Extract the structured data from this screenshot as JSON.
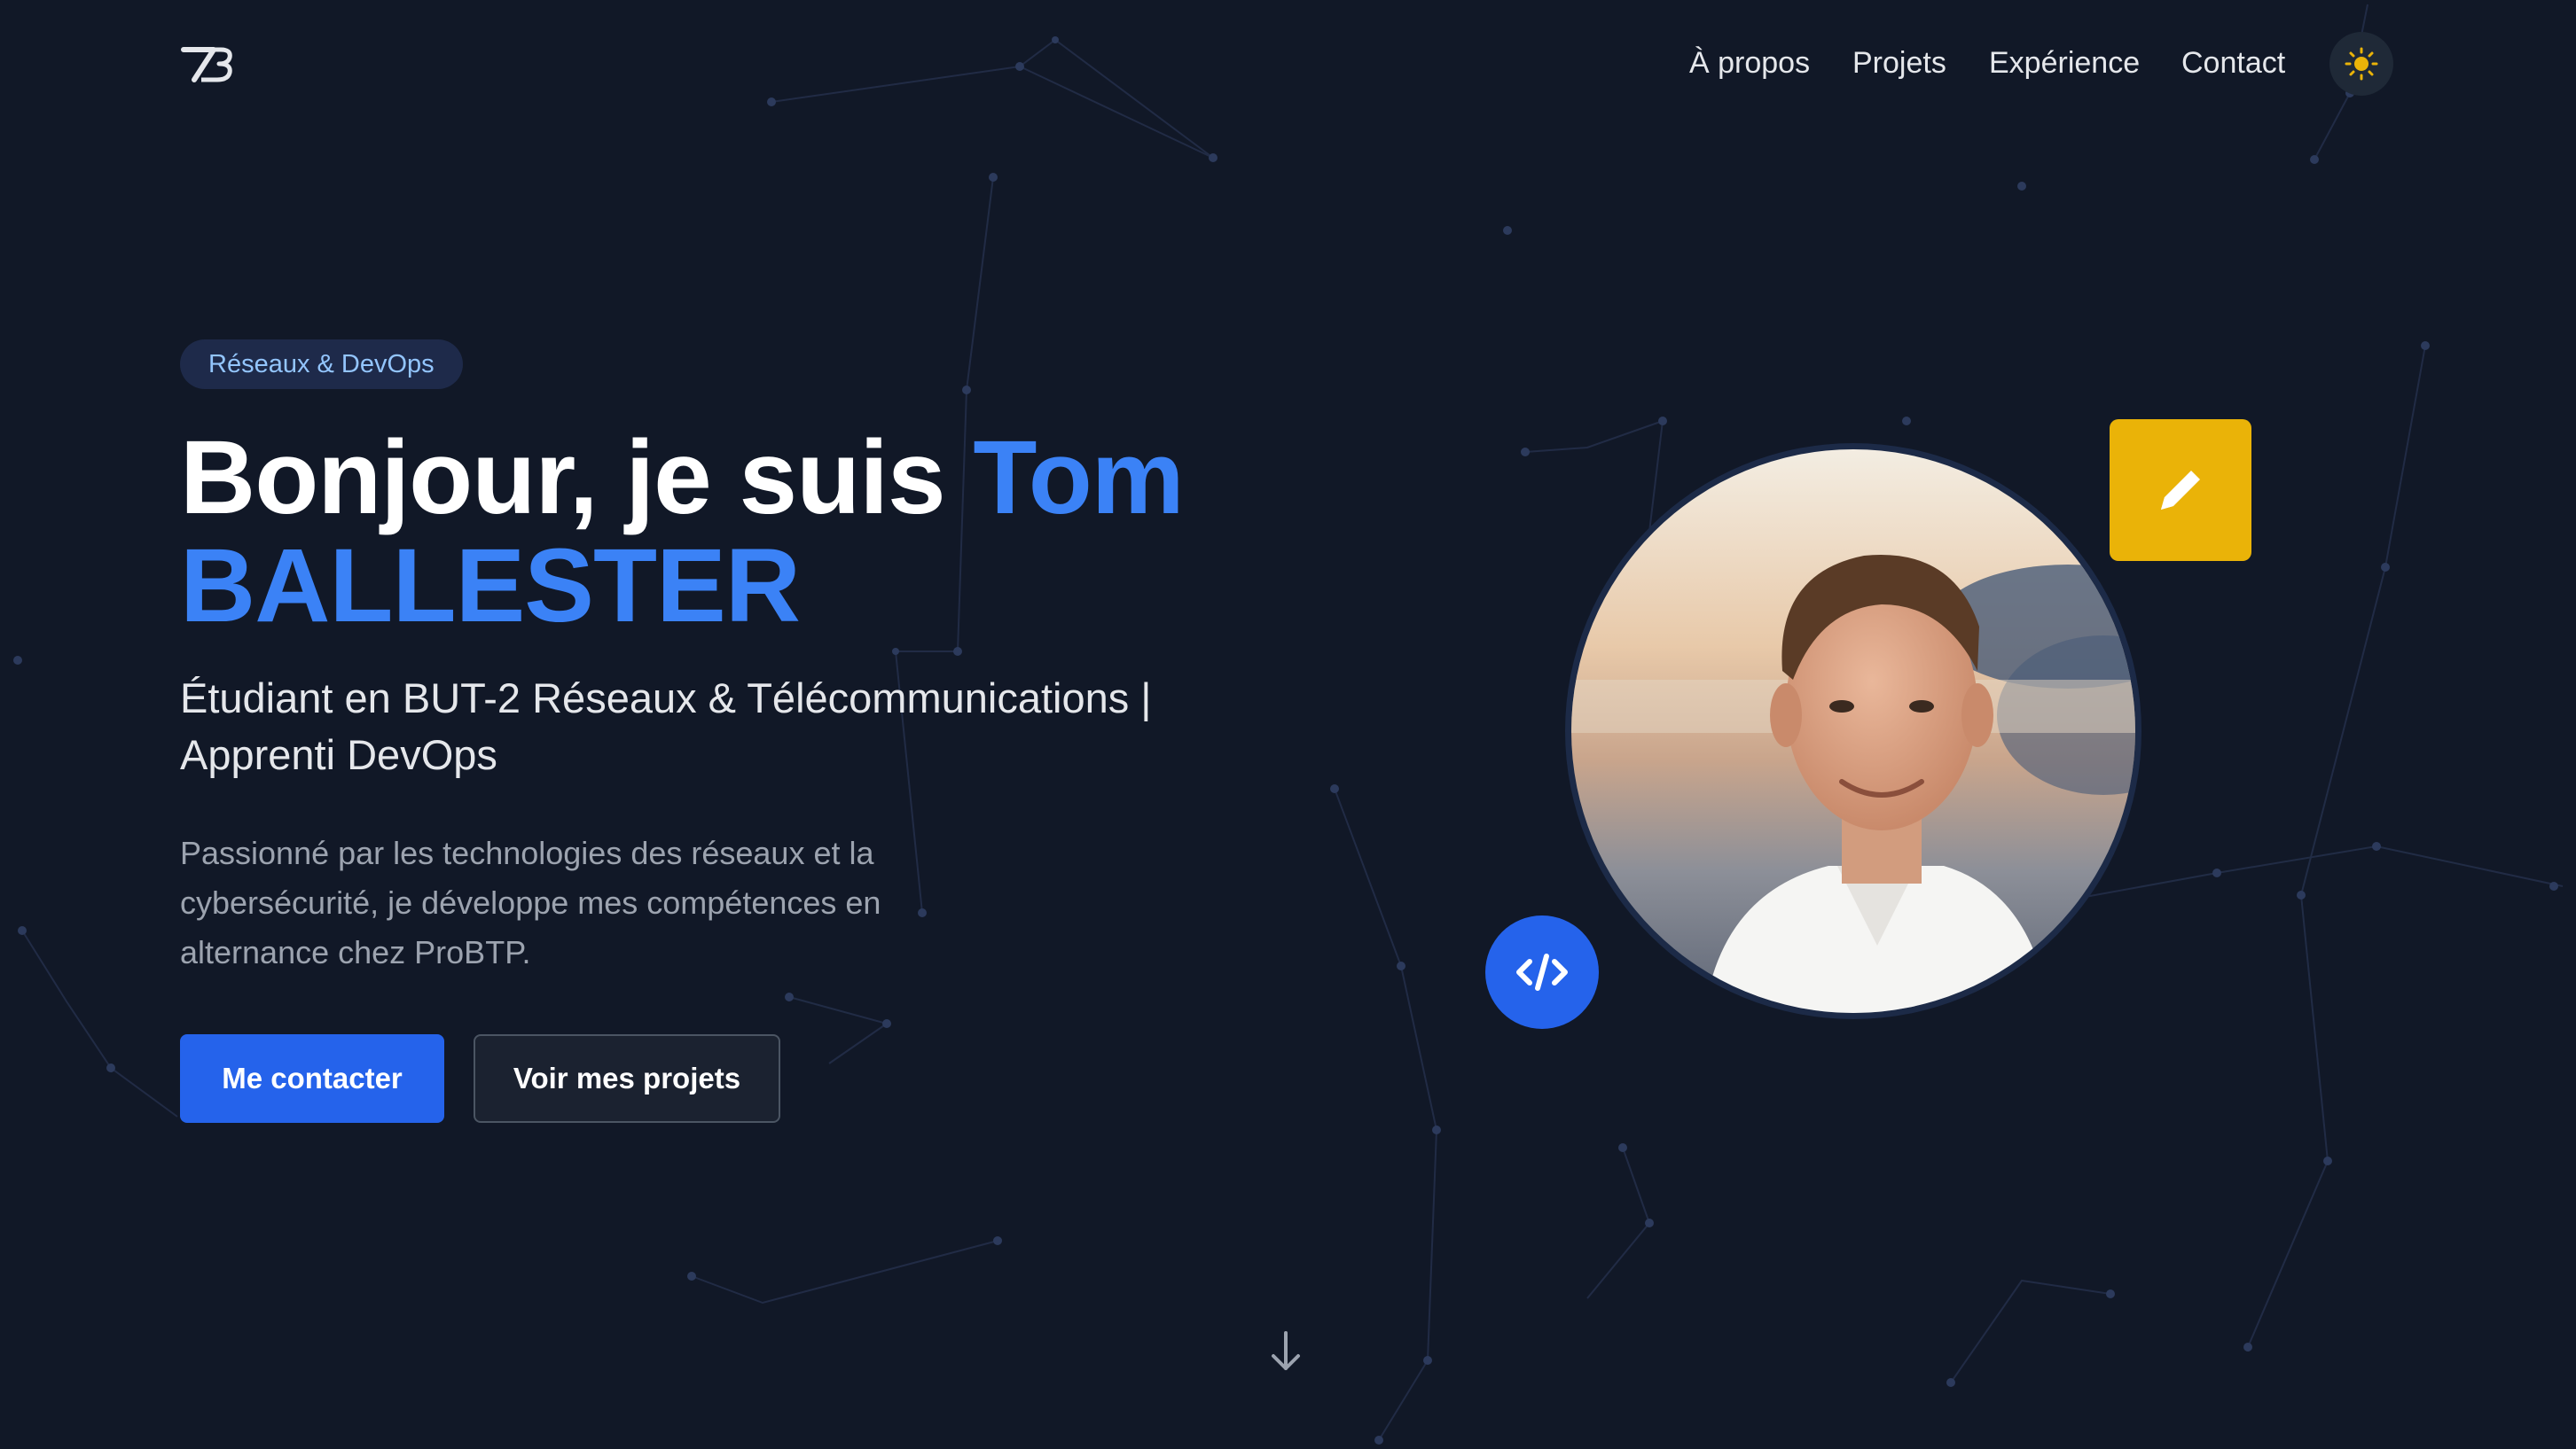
{
  "header": {
    "logo_text": "TB",
    "nav": [
      {
        "label": "À propos"
      },
      {
        "label": "Projets"
      },
      {
        "label": "Expérience"
      },
      {
        "label": "Contact"
      }
    ],
    "theme_toggle_icon": "sun-icon"
  },
  "hero": {
    "badge": "Réseaux & DevOps",
    "title_prefix": "Bonjour, je suis ",
    "title_name_line1": "Tom",
    "title_name_line2": "BALLESTER",
    "subtitle_line1": "Étudiant en BUT-2 Réseaux & Télécommunications |",
    "subtitle_line2": "Apprenti DevOps",
    "description": "Passionné par les technologies des réseaux et la cybersécurité, je développe mes compétences en alternance chez ProBTP.",
    "primary_button": "Me contacter",
    "secondary_button": "Voir mes projets",
    "scroll_icon": "arrow-down-icon"
  },
  "profile": {
    "avatar": "profile-photo",
    "badge_top_icon": "pencil-icon",
    "badge_bottom_icon": "code-icon"
  },
  "colors": {
    "background": "#111827",
    "accent": "#3b82f6",
    "primary_button": "#2563eb",
    "pencil_badge": "#eab308",
    "muted_text": "#9ca3af"
  }
}
